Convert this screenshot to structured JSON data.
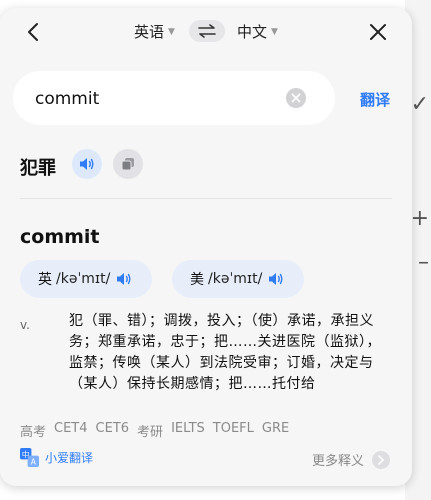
{
  "header": {
    "source_lang": "英语",
    "target_lang": "中文"
  },
  "search": {
    "value": "commit"
  },
  "translate_label": "翻译",
  "result": {
    "text": "犯罪"
  },
  "entry": {
    "word": "commit",
    "pron_uk": {
      "tag": "英",
      "ipa": "/kəˈmɪt/"
    },
    "pron_us": {
      "tag": "美",
      "ipa": "/kəˈmɪt/"
    },
    "pos": "v.",
    "definition": "犯（罪、错）；调拨，投入；（使）承诺，承担义务；郑重承诺，忠于；把……关进医院（监狱），监禁；传唤（某人）到法院受审；订婚，决定与（某人）保持长期感情；把……托付给",
    "exam_tags": [
      "高考",
      "CET4",
      "CET6",
      "考研",
      "IELTS",
      "TOEFL",
      "GRE"
    ]
  },
  "footer": {
    "brand": "小爱翻译",
    "more": "更多释义"
  },
  "colors": {
    "accent": "#2f7cf6",
    "panel_bg": "#f6f6f7"
  }
}
